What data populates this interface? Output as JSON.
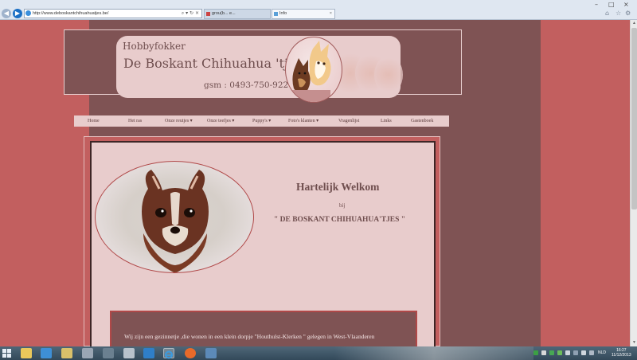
{
  "browser": {
    "address": "http://www.deboskantchihuahuatjes.be/",
    "tabs": [
      {
        "label": "grou(b... e...",
        "active": false
      },
      {
        "label": "Info",
        "active": true
      }
    ],
    "addr_actions": "⌕ ▾ ↻ ×",
    "tab_close": "×",
    "window_controls": {
      "minimize": "–",
      "maximize": "□",
      "close": "×"
    },
    "tool_icons": [
      "home-icon",
      "star-icon",
      "gear-icon"
    ],
    "tool_glyphs": {
      "home": "⌂",
      "favorites": "☆",
      "tools": "⚙"
    }
  },
  "header": {
    "subtitle": "Hobbyfokker",
    "title": "De Boskant Chihuahua 'tjes",
    "phone": "gsm : 0493-750-922"
  },
  "nav": {
    "items": [
      {
        "label": "Home"
      },
      {
        "label": "Het ras"
      },
      {
        "label": "Onze reutjes ▾"
      },
      {
        "label": "Onze teefjes ▾"
      },
      {
        "label": "Puppy's ▾"
      },
      {
        "label": "Foto's klanten ▾"
      },
      {
        "label": "Vragenlijst"
      },
      {
        "label": "Links"
      },
      {
        "label": "Gastenboek"
      }
    ]
  },
  "welcome": {
    "title": "Hartelijk Welkom",
    "sub": "bij",
    "kennel": "\" DE BOSKANT CHIHUAHUA'TJES \""
  },
  "intro": {
    "text": "Wij zijn een gezinnetje ,die wonen in een klein dorpje \"Houthulst-Klerken \" gelegen in West-Vlaanderen"
  },
  "taskbar": {
    "lang": "NLD",
    "time": "16:27",
    "date": "11/12/2013"
  },
  "colors": {
    "page_bg": "#c25f5f",
    "column_bg": "#7f5354",
    "panel_bg": "#e8cccc",
    "text": "#6f4e4e"
  }
}
